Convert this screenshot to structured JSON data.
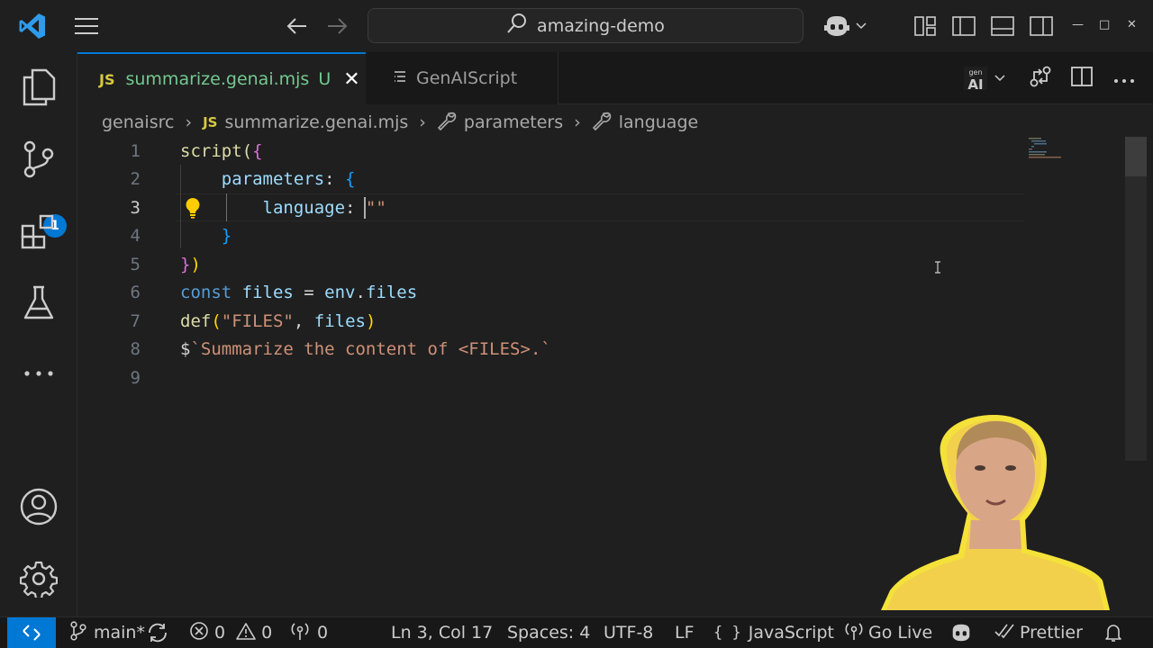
{
  "titlebar": {
    "search_text": "amazing-demo"
  },
  "activity_bar": {
    "scm_badge": "1"
  },
  "tabs": {
    "active": {
      "badge": "JS",
      "name": "summarize.genai.mjs",
      "status": "U"
    },
    "inactive": {
      "name": "GenAIScript"
    }
  },
  "breadcrumbs": {
    "folder": "genaisrc",
    "file_badge": "JS",
    "file": "summarize.genai.mjs",
    "symbol1": "parameters",
    "symbol2": "language"
  },
  "editor": {
    "line_numbers": [
      "1",
      "2",
      "3",
      "4",
      "5",
      "6",
      "7",
      "8",
      "9"
    ],
    "active_line": 3,
    "lines": [
      [
        {
          "t": "script(",
          "c": "fn"
        },
        {
          "t": "{",
          "c": "br2"
        }
      ],
      [
        {
          "t": "    parameters",
          "c": "prop"
        },
        {
          "t": ": ",
          "c": "plain"
        },
        {
          "t": "{",
          "c": "br3"
        }
      ],
      [
        {
          "t": "        language",
          "c": "prop"
        },
        {
          "t": ": ",
          "c": "plain"
        },
        {
          "t": "\"\"",
          "c": "str"
        }
      ],
      [
        {
          "t": "    ",
          "c": "plain"
        },
        {
          "t": "}",
          "c": "br3"
        }
      ],
      [
        {
          "t": "}",
          "c": "br2"
        },
        {
          "t": ")",
          "c": "br1"
        }
      ],
      [
        {
          "t": "const ",
          "c": "kw"
        },
        {
          "t": "files",
          "c": "prop"
        },
        {
          "t": " = ",
          "c": "plain"
        },
        {
          "t": "env",
          "c": "prop"
        },
        {
          "t": ".",
          "c": "plain"
        },
        {
          "t": "files",
          "c": "prop"
        }
      ],
      [
        {
          "t": "def",
          "c": "fn"
        },
        {
          "t": "(",
          "c": "br1"
        },
        {
          "t": "\"FILES\"",
          "c": "str"
        },
        {
          "t": ", ",
          "c": "plain"
        },
        {
          "t": "files",
          "c": "prop"
        },
        {
          "t": ")",
          "c": "br1"
        }
      ],
      [
        {
          "t": "$",
          "c": "plain"
        },
        {
          "t": "`Summarize the content of <FILES>.`",
          "c": "str"
        }
      ],
      []
    ]
  },
  "statusbar": {
    "branch": "main*",
    "errors": "0",
    "warnings": "0",
    "ports": "0",
    "position": "Ln 3, Col 17",
    "spaces": "Spaces: 4",
    "encoding": "UTF-8",
    "eol": "LF",
    "language": "JavaScript",
    "golive": "Go Live",
    "prettier": "Prettier"
  },
  "icons": {
    "vscode_logo": "vscode-logo-icon",
    "menu": "hamburger-menu-icon",
    "back": "arrow-left-icon",
    "forward": "arrow-right-icon",
    "search": "search-icon",
    "copilot": "copilot-icon",
    "explorer": "files-icon",
    "scm": "source-control-icon",
    "extensions": "extensions-icon",
    "testing": "beaker-icon",
    "more": "ellipsis-icon",
    "accounts": "account-icon",
    "settings": "gear-icon"
  },
  "colors": {
    "accent": "#0078d4",
    "editor_bg": "#1f1f1f",
    "untracked": "#73c991"
  }
}
